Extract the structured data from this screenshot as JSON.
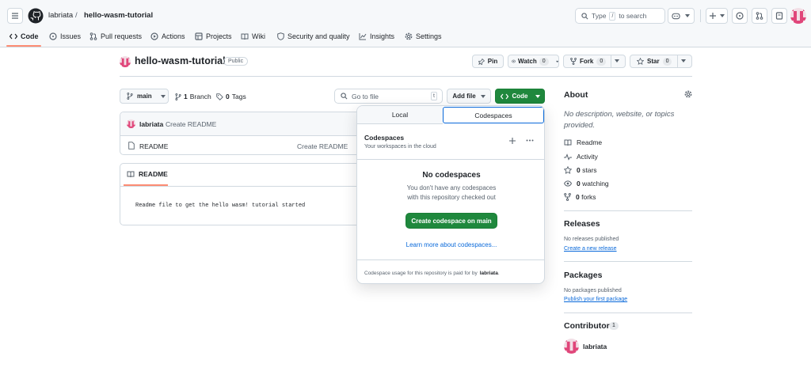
{
  "header": {
    "owner": "labriata",
    "separator": "/",
    "repo": "hello-wasm-tutorial",
    "search": {
      "type_label": "Type",
      "key": "/",
      "suffix": "to search"
    }
  },
  "tabs": [
    {
      "label": "Code",
      "icon": "code-icon"
    },
    {
      "label": "Issues",
      "icon": "issue-icon"
    },
    {
      "label": "Pull requests",
      "icon": "pull-request-icon"
    },
    {
      "label": "Actions",
      "icon": "play-icon"
    },
    {
      "label": "Projects",
      "icon": "table-icon"
    },
    {
      "label": "Wiki",
      "icon": "book-icon"
    },
    {
      "label": "Security and quality",
      "icon": "shield-icon"
    },
    {
      "label": "Insights",
      "icon": "graph-icon"
    },
    {
      "label": "Settings",
      "icon": "gear-icon"
    }
  ],
  "repo": {
    "name": "hello-wasm-tutorial",
    "visibility": "Public",
    "pin": "Pin",
    "watch": {
      "label": "Watch",
      "count": "0"
    },
    "fork": {
      "label": "Fork",
      "count": "0"
    },
    "star": {
      "label": "Star",
      "count": "0"
    }
  },
  "toolbar": {
    "branch": "main",
    "branches_count": "1",
    "branches_label": "Branch",
    "tags_count": "0",
    "tags_label": "Tags",
    "goto_placeholder": "Go to file",
    "goto_key": "t",
    "add_file": "Add file",
    "code": "Code"
  },
  "commit": {
    "author": "labriata",
    "message": "Create README"
  },
  "files": [
    {
      "name": "README",
      "message": "Create README"
    }
  ],
  "readme": {
    "tab_label": "README",
    "content": "Readme file to get the hello wasm! tutorial started"
  },
  "dropdown": {
    "tabs": [
      "Local",
      "Codespaces"
    ],
    "section_title": "Codespaces",
    "section_subtitle": "Your workspaces in the cloud",
    "empty_title": "No codespaces",
    "empty_line1": "You don't have any codespaces",
    "empty_line2": "with this repository checked out",
    "create_button": "Create codespace on main",
    "learn_link": "Learn more about codespaces...",
    "footer_prefix": "Codespace usage for this repository is paid for by",
    "footer_owner": "labriata",
    "footer_suffix": "."
  },
  "about": {
    "title": "About",
    "description": "No description, website, or topics provided.",
    "items": [
      {
        "icon": "book-icon",
        "count": "",
        "label": "Readme"
      },
      {
        "icon": "pulse-icon",
        "count": "",
        "label": "Activity"
      },
      {
        "icon": "star-icon",
        "count": "0",
        "label": "stars"
      },
      {
        "icon": "eye-icon",
        "count": "0",
        "label": "watching"
      },
      {
        "icon": "fork-icon",
        "count": "0",
        "label": "forks"
      }
    ]
  },
  "releases": {
    "title": "Releases",
    "empty": "No releases published",
    "link": "Create a new release"
  },
  "packages": {
    "title": "Packages",
    "empty": "No packages published",
    "link": "Publish your first package"
  },
  "contributors": {
    "title": "Contributors",
    "count": "1",
    "name": "labriata"
  },
  "colors": {
    "accent": "#fd8c73",
    "green": "#1f883d",
    "link": "#0969da",
    "avatar": "#e0467a"
  }
}
